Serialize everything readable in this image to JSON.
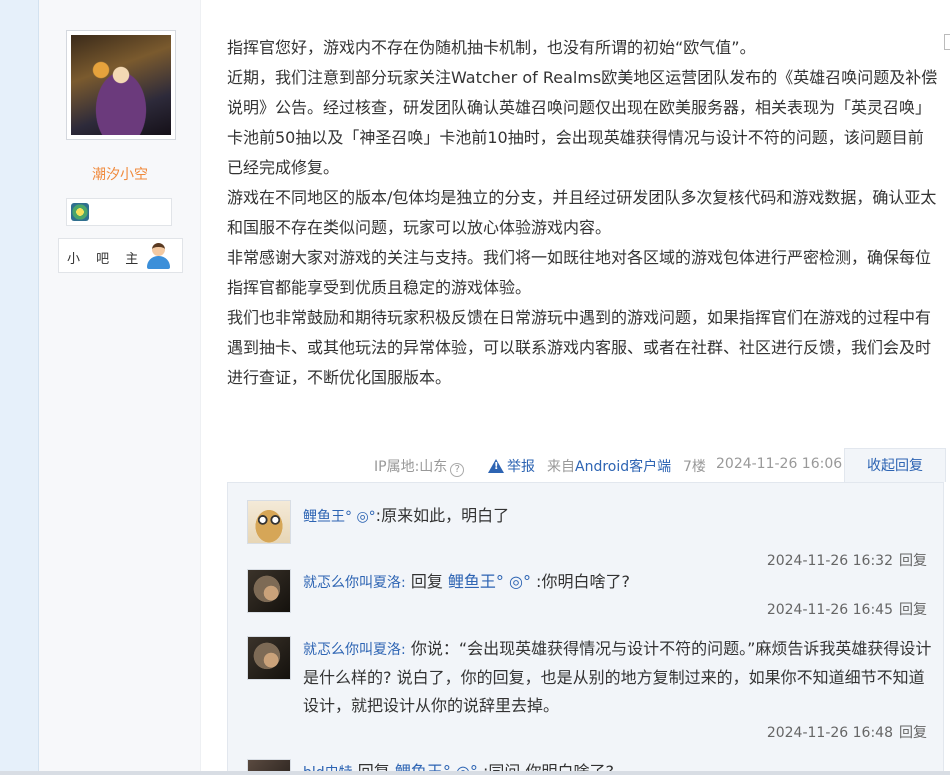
{
  "author": {
    "name": "潮汐小空",
    "role": "小 吧 主"
  },
  "post": {
    "paragraphs": [
      "指挥官您好，游戏内不存在伪随机抽卡机制，也没有所谓的初始“欧气值”。",
      "近期，我们注意到部分玩家关注Watcher of Realms欧美地区运营团队发布的《英雄召唤问题及补偿说明》公告。经过核查，研发团队确认英雄召唤问题仅出现在欧美服务器，相关表现为「英灵召唤」卡池前50抽以及「神圣召唤」卡池前10抽时，会出现英雄获得情况与设计不符的问题，该问题目前已经完成修复。",
      "游戏在不同地区的版本/包体均是独立的分支，并且经过研发团队多次复核代码和游戏数据，确认亚太和国服不存在类似问题，玩家可以放心体验游戏内容。",
      "非常感谢大家对游戏的关注与支持。我们将一如既往地对各区域的游戏包体进行严密检测，确保每位指挥官都能享受到优质且稳定的游戏体验。",
      "我们也非常鼓励和期待玩家积极反馈在日常游玩中遇到的游戏问题，如果指挥官们在游戏的过程中有遇到抽卡、或其他玩法的异常体验，可以联系游戏内客服、或者在社群、社区进行反馈，我们会及时进行查证，不断优化国服版本。"
    ],
    "meta": {
      "ip": "IP属地:山东",
      "help_glyph": "?",
      "report": "举报",
      "client_prefix": "来自",
      "client": "Android客户端",
      "floor": "7楼",
      "time": "2024-11-26 16:06",
      "collapse": "收起回复"
    }
  },
  "replies": [
    {
      "user": "鲤鱼王° ◎°",
      "reply_prefix": "",
      "target": "",
      "text": ":原来如此，明白了",
      "time": "2024-11-26 16:32",
      "action": "回复"
    },
    {
      "user": "就忑么你叫夏洛:",
      "reply_prefix": "回复 ",
      "target": "鲤鱼王° ◎°",
      "text": " :你明白啥了?",
      "time": "2024-11-26 16:45",
      "action": "回复"
    },
    {
      "user": "就忑么你叫夏洛:",
      "reply_prefix": "",
      "target": "",
      "text": "你说：“会出现英雄获得情况与设计不符的问题。”麻烦告诉我英雄获得设计是什么样的? 说白了，你的回复，也是从别的地方复制过来的，如果你不知道细节不知道设计，就把设计从你的说辞里去掉。",
      "time": "2024-11-26 16:48",
      "action": "回复"
    },
    {
      "user": "bld史特",
      "reply_prefix": "回复 ",
      "target": "鲤鱼王° ◎°",
      "text": " :同问 你明白啥了?",
      "time": "",
      "action": ""
    }
  ]
}
